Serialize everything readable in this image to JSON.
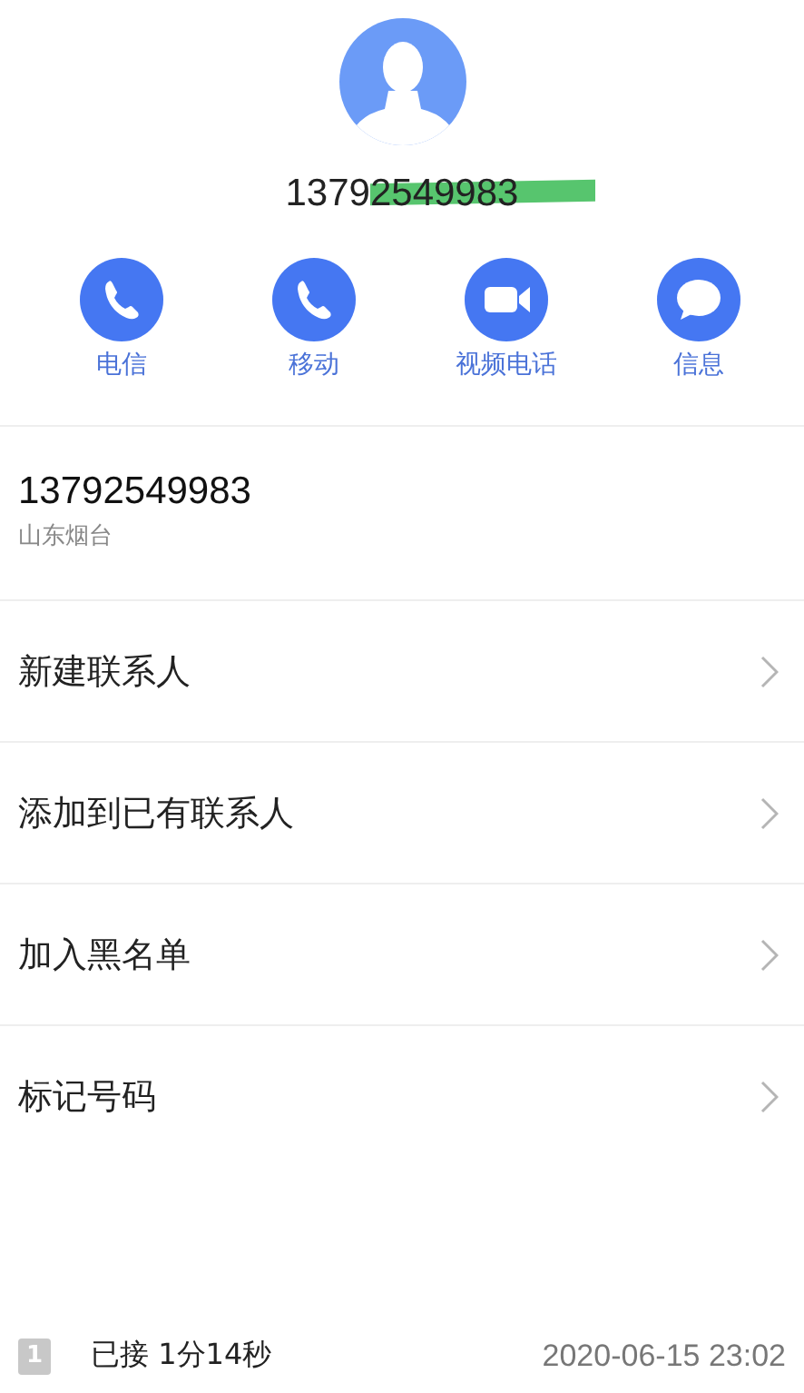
{
  "header": {
    "number": "13792549983",
    "redacted": true
  },
  "actions": [
    {
      "label": "电信",
      "kind": "phone"
    },
    {
      "label": "移动",
      "kind": "phone"
    },
    {
      "label": "视频电话",
      "kind": "video"
    },
    {
      "label": "信息",
      "kind": "message"
    }
  ],
  "info": {
    "number": "13792549983",
    "location": "山东烟台"
  },
  "menu": [
    {
      "label": "新建联系人"
    },
    {
      "label": "添加到已有联系人"
    },
    {
      "label": "加入黑名单"
    },
    {
      "label": "标记号码"
    }
  ],
  "call_log": [
    {
      "sim": "1",
      "status": "已接 1分14秒",
      "time": "2020-06-15 23:02"
    }
  ]
}
